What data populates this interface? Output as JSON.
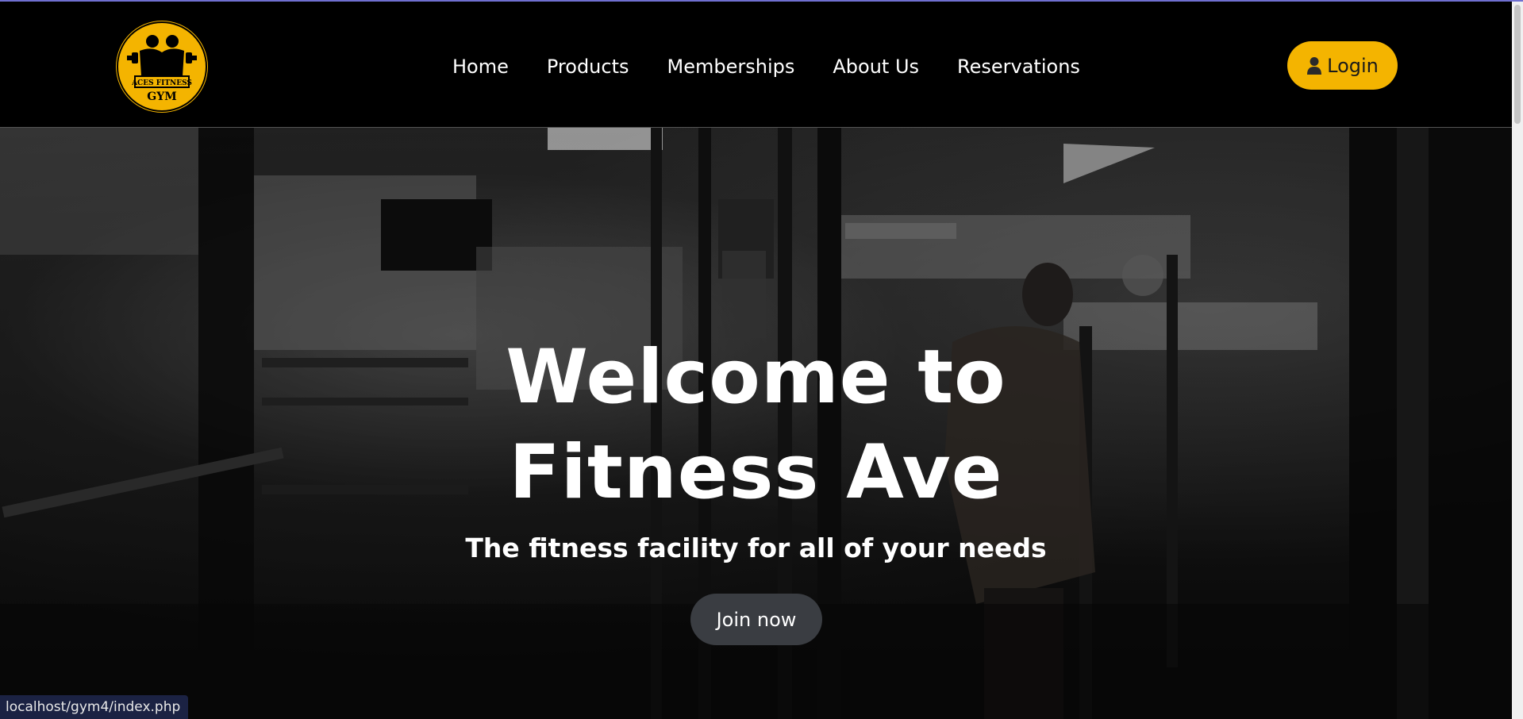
{
  "logo": {
    "line1": "ACES FITNESS",
    "line2": "GYM"
  },
  "nav": {
    "items": [
      {
        "label": "Home"
      },
      {
        "label": "Products"
      },
      {
        "label": "Memberships"
      },
      {
        "label": "About Us"
      },
      {
        "label": "Reservations"
      }
    ]
  },
  "login": {
    "label": "Login",
    "icon": "user-icon"
  },
  "hero": {
    "title_line1": "Welcome to",
    "title_line2": "Fitness Ave",
    "subtitle": "The fitness facility for all of your needs",
    "cta_label": "Join now"
  },
  "status_bar": {
    "url": "localhost/gym4/index.php"
  },
  "colors": {
    "accent": "#f4b400",
    "navbar_bg": "#000000",
    "cta_bg": "#3a3d42"
  }
}
